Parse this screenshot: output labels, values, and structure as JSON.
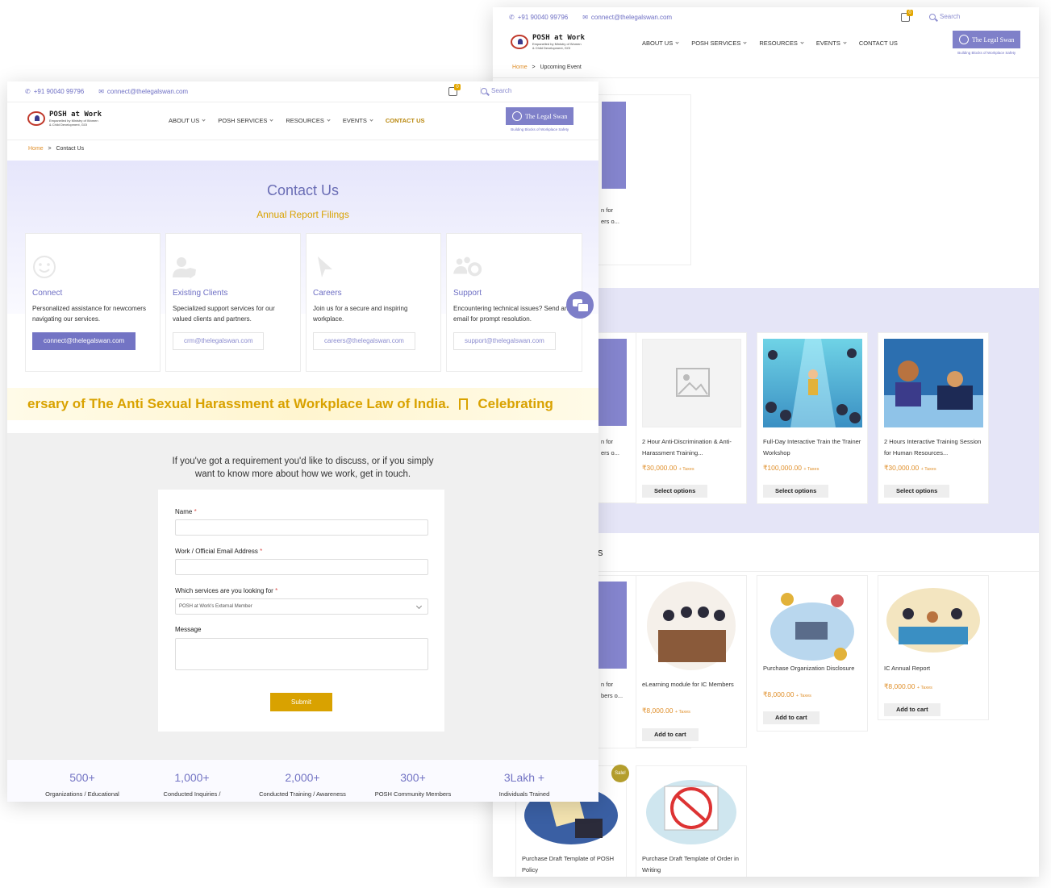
{
  "topbar": {
    "phone": "+91 90040 99796",
    "email": "connect@thelegalswan.com",
    "cart_count": "0",
    "search_placeholder": "Search"
  },
  "logo": {
    "title": "POSH at Work",
    "subtitle": "Empanelled by Ministry of Women & Child Development, GOI"
  },
  "nav": {
    "about": "ABOUT US",
    "services": "POSH SERVICES",
    "resources": "RESOURCES",
    "events": "EVENTS",
    "contact": "CONTACT US"
  },
  "brand": {
    "name": "The Legal Swan",
    "tagline": "Building Blocks of Workplace Safety"
  },
  "windowA": {
    "breadcrumb": {
      "home": "Home",
      "sep": ">",
      "current": "Contact Us"
    },
    "title": "Contact Us",
    "subtitle": "Annual Report Filings",
    "cards": [
      {
        "title": "Connect",
        "desc": "Personalized assistance for newcomers navigating our services.",
        "button": "connect@thelegalswan.com"
      },
      {
        "title": "Existing Clients",
        "desc": "Specialized support services for our valued clients and partners.",
        "button": "crm@thelegalswan.com"
      },
      {
        "title": "Careers",
        "desc": "Join us for a secure and inspiring workplace.",
        "button": "careers@thelegalswan.com"
      },
      {
        "title": "Support",
        "desc": "Encountering technical issues? Send an email for prompt resolution.",
        "button": "support@thelegalswan.com"
      }
    ],
    "marquee": {
      "part1": "ersary of The Anti Sexual Harassment at Workplace Law of India.",
      "part2": "Celebrating"
    },
    "intro": "If you've got a requirement you'd like to discuss, or if you simply want to know more about how we work, get in touch.",
    "form": {
      "name_label": "Name",
      "email_label": "Work / Official Email Address",
      "services_label": "Which services are you looking for",
      "services_value": "POSH at Work's External Member",
      "message_label": "Message",
      "required": "*",
      "submit": "Submit"
    },
    "stats": [
      {
        "num": "500+",
        "label": "Organizations / Educational"
      },
      {
        "num": "1,000+",
        "label": "Conducted Inquiries /"
      },
      {
        "num": "2,000+",
        "label": "Conducted Training / Awareness"
      },
      {
        "num": "300+",
        "label": "POSH Community Members"
      },
      {
        "num": "3Lakh +",
        "label": "Individuals Trained"
      }
    ]
  },
  "windowB": {
    "breadcrumb": {
      "home": "Home",
      "sep": ">",
      "current": "Upcoming Event"
    },
    "partial": {
      "a": "n for",
      "b": "ers o...",
      "c": "n for",
      "d": "ers o...",
      "e": "n for",
      "f": "bers o...",
      "s": "s",
      "sale": "Sale!"
    },
    "events": [
      {
        "title": "2 Hour Anti-Discrimination & Anti-Harassment Training...",
        "price": "₹30,000.00",
        "taxes": "+ Taxes",
        "button": "Select options"
      },
      {
        "title": "Full-Day Interactive Train the Trainer Workshop",
        "price": "₹100,000.00",
        "taxes": "+ Taxes",
        "button": "Select options"
      },
      {
        "title": "2 Hours Interactive Training Session for Human Resources...",
        "price": "₹30,000.00",
        "taxes": "+ Taxes",
        "button": "Select options"
      }
    ],
    "products": [
      {
        "title": "eLearning module for IC Members",
        "price": "₹8,000.00",
        "taxes": "+ Taxes",
        "button": "Add to cart"
      },
      {
        "title": "Purchase Organization Disclosure",
        "price": "₹8,000.00",
        "taxes": "+ Taxes",
        "button": "Add to cart"
      },
      {
        "title": "IC Annual Report",
        "price": "₹8,000.00",
        "taxes": "+ Taxes",
        "button": "Add to cart"
      }
    ],
    "drafts": [
      {
        "title": "Purchase Draft Template of POSH Policy"
      },
      {
        "title": "Purchase Draft Template of Order in Writing"
      }
    ]
  }
}
